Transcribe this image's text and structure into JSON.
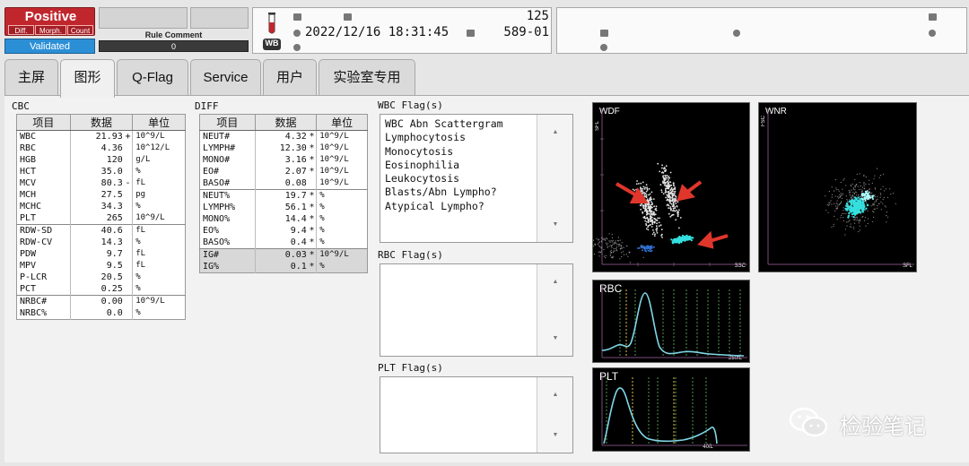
{
  "status": {
    "result": "Positive",
    "subflags": [
      "Diff.",
      "Morph.",
      "Count"
    ],
    "validated": "Validated"
  },
  "rule_comment": {
    "label": "Rule Comment",
    "count": "0"
  },
  "sample": {
    "sample_no": "125",
    "datetime": "2022/12/16 18:31:45",
    "rack_pos": "589-01",
    "mode_badge": "WB"
  },
  "tabs": [
    "主屏",
    "图形",
    "Q-Flag",
    "Service",
    "用户",
    "实验室专用"
  ],
  "active_tab": 1,
  "cbc": {
    "title": "CBC",
    "headers": [
      "项目",
      "数据",
      "单位"
    ],
    "groups": [
      [
        {
          "item": "WBC",
          "value": "21.93",
          "mark": "+",
          "unit": "10^9/L"
        },
        {
          "item": "RBC",
          "value": "4.36",
          "mark": "",
          "unit": "10^12/L"
        },
        {
          "item": "HGB",
          "value": "120",
          "mark": "",
          "unit": "g/L"
        },
        {
          "item": "HCT",
          "value": "35.0",
          "mark": "",
          "unit": "%"
        },
        {
          "item": "MCV",
          "value": "80.3",
          "mark": "-",
          "unit": "fL"
        },
        {
          "item": "MCH",
          "value": "27.5",
          "mark": "",
          "unit": "pg"
        },
        {
          "item": "MCHC",
          "value": "34.3",
          "mark": "",
          "unit": "%"
        },
        {
          "item": "PLT",
          "value": "265",
          "mark": "",
          "unit": "10^9/L"
        }
      ],
      [
        {
          "item": "RDW-SD",
          "value": "40.6",
          "mark": "",
          "unit": "fL"
        },
        {
          "item": "RDW-CV",
          "value": "14.3",
          "mark": "",
          "unit": "%"
        },
        {
          "item": "PDW",
          "value": "9.7",
          "mark": "",
          "unit": "fL"
        },
        {
          "item": "MPV",
          "value": "9.5",
          "mark": "",
          "unit": "fL"
        },
        {
          "item": "P-LCR",
          "value": "20.5",
          "mark": "",
          "unit": "%"
        },
        {
          "item": "PCT",
          "value": "0.25",
          "mark": "",
          "unit": "%"
        }
      ],
      [
        {
          "item": "NRBC#",
          "value": "0.00",
          "mark": "",
          "unit": "10^9/L"
        },
        {
          "item": "NRBC%",
          "value": "0.0",
          "mark": "",
          "unit": "%"
        }
      ]
    ]
  },
  "diff": {
    "title": "DIFF",
    "headers": [
      "项目",
      "数据",
      "单位"
    ],
    "groups": [
      [
        {
          "item": "NEUT#",
          "value": "4.32",
          "mark": "*",
          "unit": "10^9/L"
        },
        {
          "item": "LYMPH#",
          "value": "12.30",
          "mark": "*",
          "unit": "10^9/L"
        },
        {
          "item": "MONO#",
          "value": "3.16",
          "mark": "*",
          "unit": "10^9/L"
        },
        {
          "item": "EO#",
          "value": "2.07",
          "mark": "*",
          "unit": "10^9/L"
        },
        {
          "item": "BASO#",
          "value": "0.08",
          "mark": "",
          "unit": "10^9/L"
        }
      ],
      [
        {
          "item": "NEUT%",
          "value": "19.7",
          "mark": "*",
          "unit": "%"
        },
        {
          "item": "LYMPH%",
          "value": "56.1",
          "mark": "*",
          "unit": "%"
        },
        {
          "item": "MONO%",
          "value": "14.4",
          "mark": "*",
          "unit": "%"
        },
        {
          "item": "EO%",
          "value": "9.4",
          "mark": "*",
          "unit": "%"
        },
        {
          "item": "BASO%",
          "value": "0.4",
          "mark": "*",
          "unit": "%"
        }
      ],
      [
        {
          "item": "IG#",
          "value": "0.03",
          "mark": "*",
          "unit": "10^9/L"
        },
        {
          "item": "IG%",
          "value": "0.1",
          "mark": "*",
          "unit": "%"
        }
      ]
    ]
  },
  "flags": {
    "wbc_title": "WBC Flag(s)",
    "wbc": [
      "WBC Abn Scattergram",
      "Lymphocytosis",
      "Monocytosis",
      "Eosinophilia",
      "Leukocytosis",
      "Blasts/Abn Lympho?",
      "Atypical Lympho?"
    ],
    "rbc_title": "RBC Flag(s)",
    "rbc": [],
    "plt_title": "PLT Flag(s)",
    "plt": []
  },
  "plots": {
    "wdf": {
      "label": "WDF",
      "y_axis": "SFL",
      "x_axis": "SSC"
    },
    "wnr": {
      "label": "WNR",
      "y_axis": "FSC",
      "x_axis": "SFL"
    },
    "rbc": {
      "label": "RBC",
      "x_max": "250fL"
    },
    "plt": {
      "label": "PLT",
      "x_max": "40fL"
    }
  },
  "watermark": "检验笔记",
  "colors": {
    "positive_red": "#c0272d",
    "validated_blue": "#2b8fd6",
    "histogram_cyan": "#7fd6e6",
    "scatter_white": "#e6e6e6",
    "scatter_cyan": "#35e0e0",
    "arrow_red": "#e0362b"
  },
  "icons": [
    "flask-icon",
    "barcode-icon",
    "clock-icon",
    "rack-icon",
    "comment-icon",
    "person-icon",
    "stethoscope-icon",
    "ward-icon"
  ]
}
